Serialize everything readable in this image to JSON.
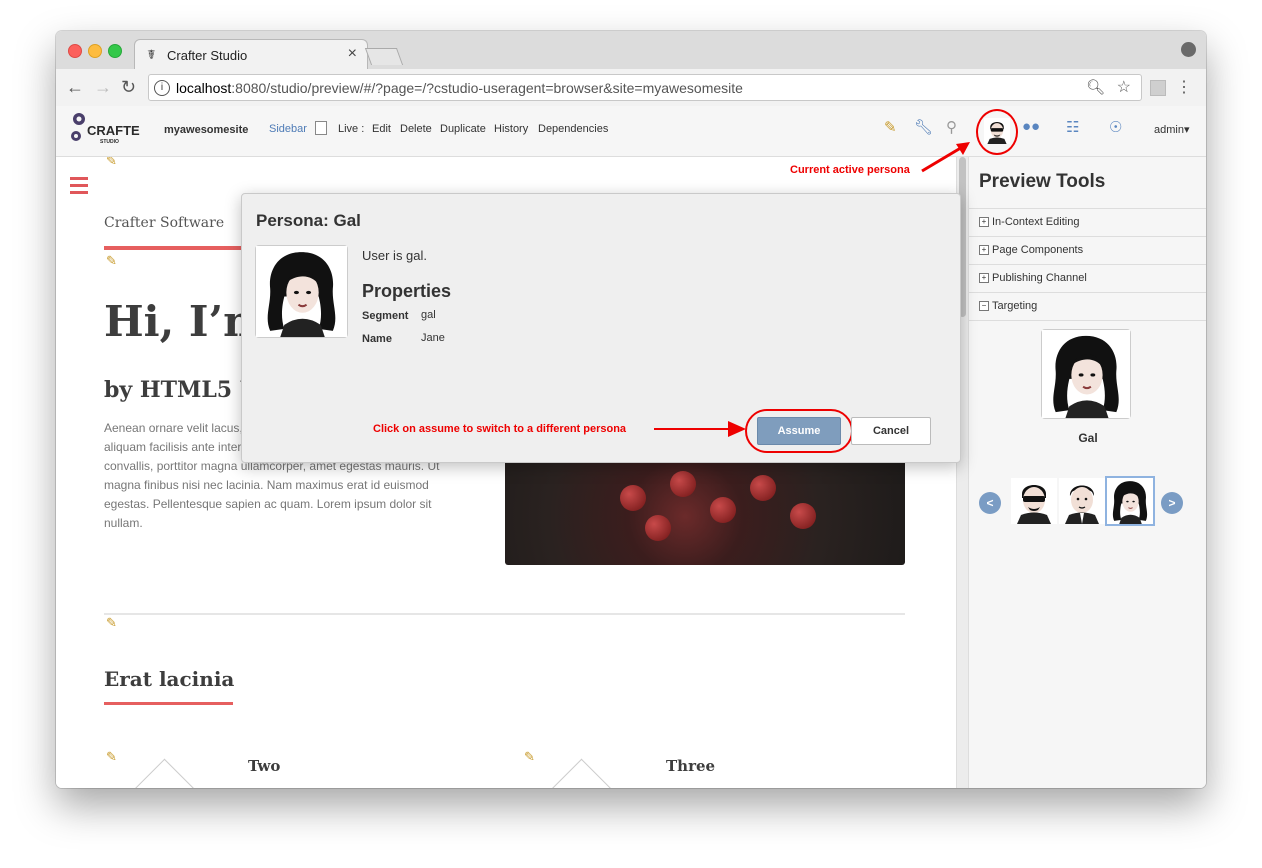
{
  "browser": {
    "tab_title": "Crafter Studio",
    "tab_favicon": "crafter-favicon",
    "url_host": "localhost",
    "url_rest": ":8080/studio/preview/#/?page=/?cstudio-useragent=browser&site=myawesomesite"
  },
  "studio": {
    "site_name": "myawesomesite",
    "sidebar_label": "Sidebar",
    "live_label": "Live :",
    "actions": [
      "Edit",
      "Delete",
      "Duplicate",
      "History",
      "Dependencies"
    ],
    "user_menu": "admin",
    "toolbar_icons": [
      "pencil-icon",
      "wrench-icon",
      "search-icon",
      "persona-icon",
      "users-icon",
      "sitemap-icon",
      "help-icon"
    ]
  },
  "page": {
    "brand": "Crafter Software",
    "headline": "Hi, I’m",
    "subhead": "by HTML5 UI",
    "paragraph": "Aenean ornare velit lacus, ac varius enim ullamcorper eu. Proin aliquam facilisis ante interdum congue. Integer mollis, nisl amet convallis, porttitor magna ullamcorper, amet egestas mauris. Ut magna finibus nisi nec lacinia. Nam maximus erat id euismod egestas. Pellentesque sapien ac quam. Lorem ipsum dolor sit nullam.",
    "section_title": "Erat lacinia",
    "features": [
      "Two",
      "Three"
    ]
  },
  "preview_tools": {
    "title": "Preview Tools",
    "sections": [
      {
        "label": "In-Context Editing",
        "expanded": false
      },
      {
        "label": "Page Components",
        "expanded": false
      },
      {
        "label": "Publishing Channel",
        "expanded": false
      },
      {
        "label": "Targeting",
        "expanded": true
      }
    ],
    "current_persona": "Gal",
    "carousel_prev": "<",
    "carousel_next": ">",
    "carousel_personas": [
      "persona-sunglasses",
      "persona-man",
      "persona-gal"
    ]
  },
  "modal": {
    "title": "Persona: Gal",
    "description": "User is gal.",
    "properties_heading": "Properties",
    "properties": [
      {
        "key": "Segment",
        "value": "gal"
      },
      {
        "key": "Name",
        "value": "Jane"
      }
    ],
    "assume_label": "Assume",
    "cancel_label": "Cancel"
  },
  "annotations": {
    "active_persona": "Current active persona",
    "assume_hint": "Click on assume to switch to a different persona",
    "color": "#e00000"
  },
  "colors": {
    "accent_red": "#e65f5f",
    "link_blue": "#4e7bb6",
    "button_blue": "#7f9dbd"
  }
}
